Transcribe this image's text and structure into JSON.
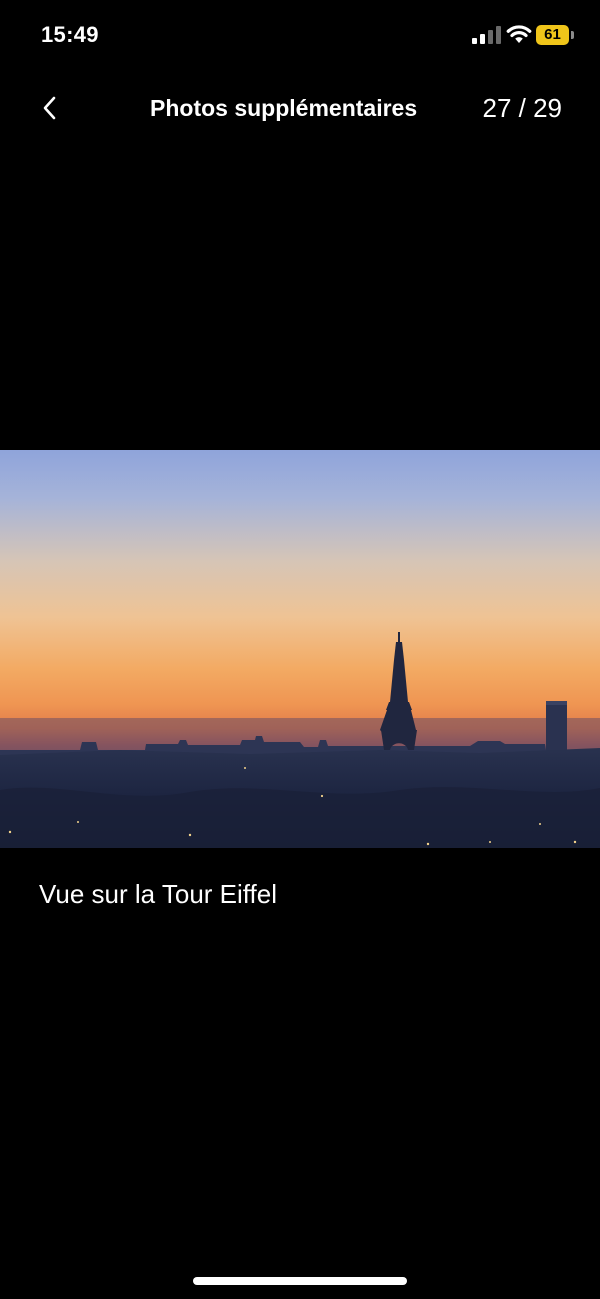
{
  "status_bar": {
    "time": "15:49",
    "battery_level": "61",
    "battery_color": "#f0c51a",
    "signal_icon": "cellular-signal-icon",
    "wifi_icon": "wifi-icon"
  },
  "header": {
    "back_icon": "chevron-left-icon",
    "title": "Photos supplémentaires",
    "counter": "27 / 29"
  },
  "photo": {
    "subject": "sunset-skyline-eiffel-tower"
  },
  "caption": "Vue sur la Tour Eiffel"
}
